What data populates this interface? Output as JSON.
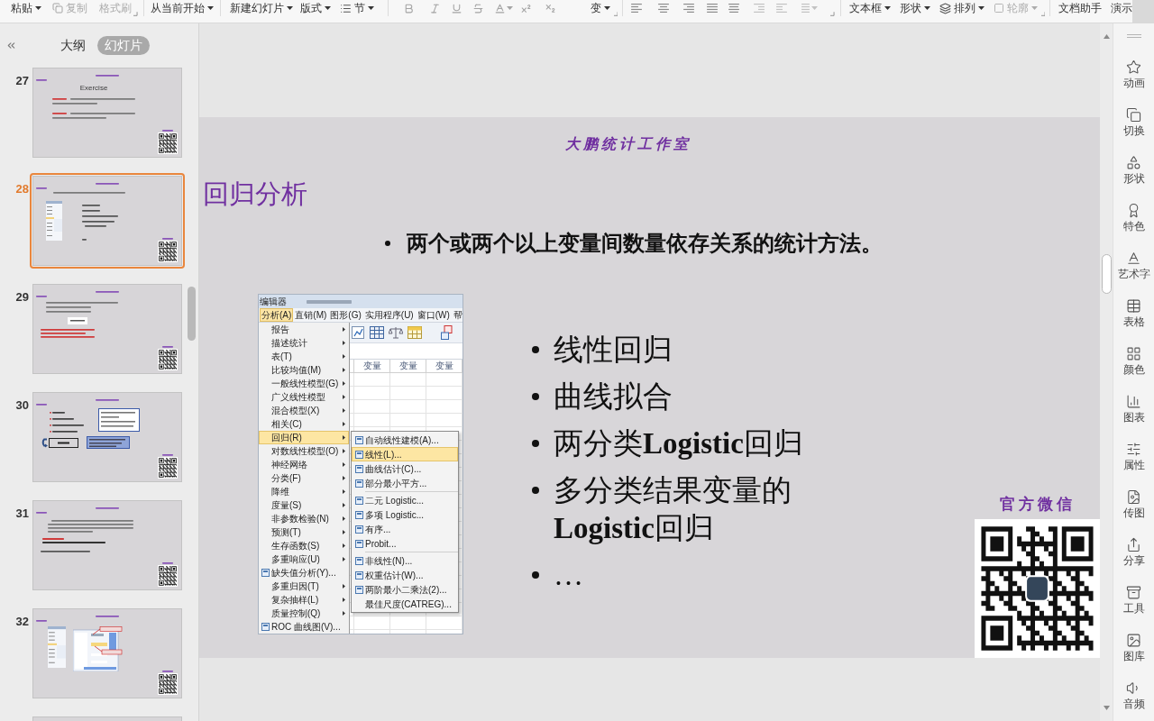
{
  "toolbar": {
    "items": [
      {
        "label": "粘贴",
        "disabled": false
      },
      {
        "label": "复制",
        "disabled": true
      },
      {
        "label": "格式刷",
        "disabled": true
      },
      {
        "label": "从当前开始",
        "disabled": false
      },
      {
        "label": "新建幻灯片",
        "disabled": false
      },
      {
        "label": "版式",
        "disabled": false
      },
      {
        "label": "节",
        "disabled": false
      },
      {
        "label": "变",
        "disabled": false
      },
      {
        "label": "文本框",
        "disabled": false
      },
      {
        "label": "形状",
        "disabled": false
      },
      {
        "label": "排列",
        "disabled": false
      },
      {
        "label": "轮廓",
        "disabled": true
      },
      {
        "label": "文档助手",
        "disabled": false
      },
      {
        "label": "演示",
        "disabled": false
      }
    ]
  },
  "panel": {
    "tabs": [
      {
        "label": "大纲",
        "selected": false
      },
      {
        "label": "幻灯片",
        "selected": true
      }
    ]
  },
  "slides": [
    {
      "number": "27",
      "selected": false,
      "kind": "exercise",
      "heading": "Exercise"
    },
    {
      "number": "28",
      "selected": true,
      "kind": "bullets"
    },
    {
      "number": "29",
      "selected": false,
      "kind": "formula"
    },
    {
      "number": "30",
      "selected": false,
      "kind": "conditions"
    },
    {
      "number": "31",
      "selected": false,
      "kind": "text"
    },
    {
      "number": "32",
      "selected": false,
      "kind": "screens"
    },
    {
      "selected": false,
      "kind": "blank"
    }
  ],
  "slide": {
    "brand": "大鹏统计工作室",
    "title": "回归分析",
    "intro": "两个或两个以上变量间数量依存关系的统计方法。",
    "bullets": [
      "线性回归",
      "曲线拟合",
      "两分类**Logistic**回归",
      "多分类结果变量的**Logistic**回归",
      "…"
    ],
    "wechat_label": "官方微信"
  },
  "spss": {
    "title": "编辑器",
    "menubar": [
      {
        "label": "分析(A)",
        "selected": true
      },
      {
        "label": "直销(M)",
        "selected": false
      },
      {
        "label": "图形(G)",
        "selected": false
      },
      {
        "label": "实用程序(U)",
        "selected": false
      },
      {
        "label": "窗口(W)",
        "selected": false
      },
      {
        "label": "帮",
        "selected": false
      }
    ],
    "menu": [
      {
        "label": "报告",
        "kind": "submenu",
        "selected": false
      },
      {
        "label": "描述统计",
        "kind": "submenu",
        "selected": false
      },
      {
        "label": "表(T)",
        "kind": "submenu",
        "selected": false
      },
      {
        "label": "比较均值(M)",
        "kind": "submenu",
        "selected": false
      },
      {
        "label": "一般线性模型(G)",
        "kind": "submenu",
        "selected": false
      },
      {
        "label": "广义线性模型",
        "kind": "submenu",
        "selected": false
      },
      {
        "label": "混合模型(X)",
        "kind": "submenu",
        "selected": false
      },
      {
        "label": "相关(C)",
        "kind": "submenu",
        "selected": false
      },
      {
        "label": "回归(R)",
        "kind": "submenu",
        "selected": true
      },
      {
        "label": "对数线性模型(O)",
        "kind": "submenu",
        "selected": false
      },
      {
        "label": "神经网络",
        "kind": "submenu",
        "selected": false
      },
      {
        "label": "分类(F)",
        "kind": "submenu",
        "selected": false
      },
      {
        "label": "降维",
        "kind": "submenu",
        "selected": false
      },
      {
        "label": "度量(S)",
        "kind": "submenu",
        "selected": false
      },
      {
        "label": "非参数检验(N)",
        "kind": "submenu",
        "selected": false
      },
      {
        "label": "预测(T)",
        "kind": "submenu",
        "selected": false
      },
      {
        "label": "生存函数(S)",
        "kind": "submenu",
        "selected": false
      },
      {
        "label": "多重响应(U)",
        "kind": "submenu",
        "selected": false
      },
      {
        "label": "缺失值分析(Y)...",
        "kind": "command",
        "selected": false
      },
      {
        "label": "多重归因(T)",
        "kind": "submenu",
        "selected": false
      },
      {
        "label": "复杂抽样(L)",
        "kind": "submenu",
        "selected": false
      },
      {
        "label": "质量控制(Q)",
        "kind": "submenu",
        "selected": false
      },
      {
        "label": "ROC 曲线图(V)...",
        "kind": "command",
        "selected": false
      }
    ],
    "submenu": [
      [
        {
          "label": "自动线性建模(A)...",
          "kind": "dialog",
          "selected": false
        },
        {
          "label": "线性(L)...",
          "kind": "dialog",
          "selected": true
        },
        {
          "label": "曲线估计(C)...",
          "kind": "dialog",
          "selected": false
        },
        {
          "label": "部分最小平方...",
          "kind": "dialog",
          "selected": false
        }
      ],
      [
        {
          "label": "二元 Logistic...",
          "kind": "dialog",
          "selected": false
        },
        {
          "label": "多项 Logistic...",
          "kind": "dialog",
          "selected": false
        },
        {
          "label": "有序...",
          "kind": "dialog",
          "selected": false
        },
        {
          "label": "Probit...",
          "kind": "dialog",
          "selected": false
        }
      ],
      [
        {
          "label": "非线性(N)...",
          "kind": "dialog",
          "selected": false
        },
        {
          "label": "权重估计(W)...",
          "kind": "dialog",
          "selected": false
        },
        {
          "label": "两阶最小二乘法(2)...",
          "kind": "dialog",
          "selected": false
        },
        {
          "label": "最佳尺度(CATREG)...",
          "kind": "plain",
          "selected": false
        }
      ]
    ],
    "columns": [
      "变量",
      "变量",
      "变量"
    ]
  },
  "side_tools": [
    {
      "label": "动画"
    },
    {
      "label": "切换"
    },
    {
      "label": "形状"
    },
    {
      "label": "特色"
    },
    {
      "label": "艺术字"
    },
    {
      "label": "表格"
    },
    {
      "label": "颜色"
    },
    {
      "label": "图表"
    },
    {
      "label": "属性"
    },
    {
      "label": "传图"
    },
    {
      "label": "分享"
    },
    {
      "label": "工具"
    },
    {
      "label": "图库"
    },
    {
      "label": "音频"
    }
  ]
}
